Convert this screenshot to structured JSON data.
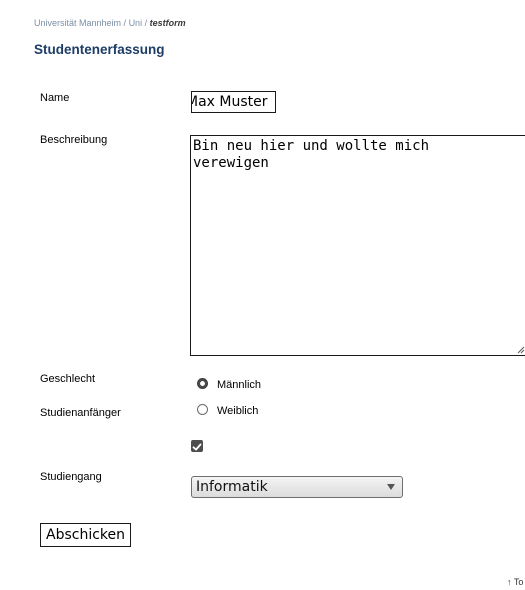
{
  "breadcrumb": {
    "items": [
      "Universität Mannheim",
      "Uni"
    ],
    "separator": " / ",
    "current": "testform"
  },
  "page_title": "Studentenerfassung",
  "form": {
    "name": {
      "label": "Name",
      "value": "Max Muster"
    },
    "description": {
      "label": "Beschreibung",
      "value": "Bin neu hier und wollte mich\nverewigen"
    },
    "gender": {
      "label": "Geschlecht",
      "options": [
        {
          "label": "Männlich",
          "checked": true
        },
        {
          "label": "Weiblich",
          "checked": false
        }
      ]
    },
    "freshman": {
      "label": "Studienanfänger",
      "checked": true
    },
    "program": {
      "label": "Studiengang",
      "selected": "Informatik"
    },
    "submit_label": "Abschicken"
  },
  "footer": {
    "to_top_arrow": "↑",
    "to_top_label": "To"
  },
  "colors": {
    "title": "#1d3c66",
    "breadcrumb": "#7a8fa6"
  }
}
